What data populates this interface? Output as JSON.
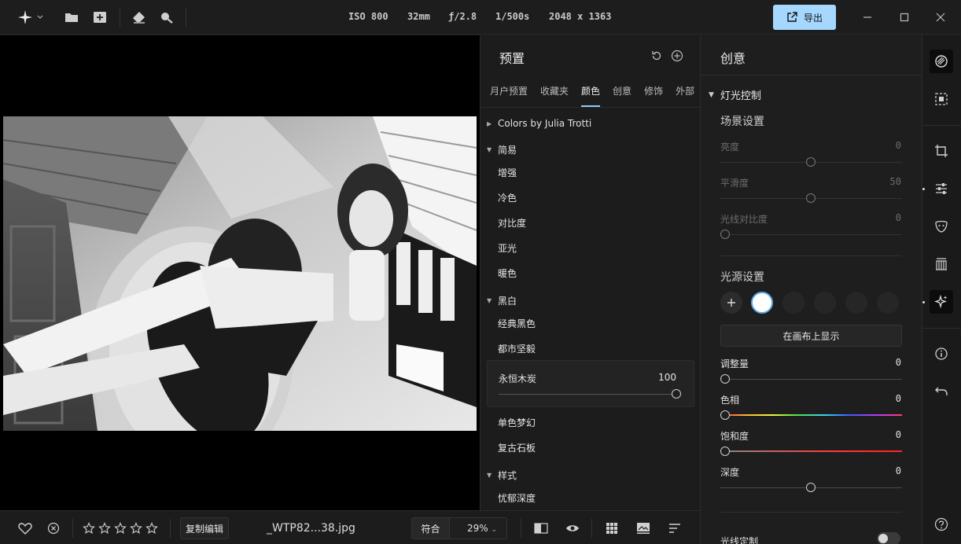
{
  "topbar": {
    "exif": {
      "iso": "ISO 800",
      "focal": "32mm",
      "aperture": "ƒ/2.8",
      "shutter": "1/500s",
      "dimensions": "2048 x 1363"
    },
    "export_label": "导出",
    "accent": "#a6d8ff"
  },
  "presets": {
    "title": "预置",
    "tabs": [
      {
        "label": "月户预置",
        "active": false
      },
      {
        "label": "收藏夹",
        "active": false
      },
      {
        "label": "颜色",
        "active": true
      },
      {
        "label": "创意",
        "active": false
      },
      {
        "label": "修饰",
        "active": false
      },
      {
        "label": "外部",
        "active": false
      }
    ],
    "groups": {
      "julia": "Colors by Julia Trotti",
      "simple": "简易",
      "bw": "黑白",
      "style": "样式"
    },
    "simple_items": [
      "增强",
      "冷色",
      "对比度",
      "亚光",
      "暖色"
    ],
    "bw_items": [
      "经典黑色",
      "都市坚毅"
    ],
    "selected": {
      "name": "永恒木炭",
      "value": "100",
      "amount_fraction": 1.0
    },
    "bw_more": [
      "单色梦幻",
      "复古石板"
    ],
    "style_items": [
      "忧郁深度"
    ]
  },
  "creative": {
    "title": "创意",
    "section": "灯光控制",
    "scene": {
      "title": "场景设置",
      "sliders": [
        {
          "label": "亮度",
          "value": "0"
        },
        {
          "label": "平滑度",
          "value": "50"
        },
        {
          "label": "光线对比度",
          "value": "0"
        }
      ]
    },
    "light": {
      "title": "光源设置",
      "show_label": "在画布上显示",
      "sliders": [
        {
          "label": "调整量",
          "value": "0"
        },
        {
          "label": "色相",
          "value": "0"
        },
        {
          "label": "饱和度",
          "value": "0"
        },
        {
          "label": "深度",
          "value": "0"
        }
      ]
    },
    "custom_label": "光线定制"
  },
  "bottombar": {
    "copy_label": "复制编辑",
    "filename": "_WTP82...38.jpg",
    "fit_label": "符合",
    "zoom": "29%"
  }
}
